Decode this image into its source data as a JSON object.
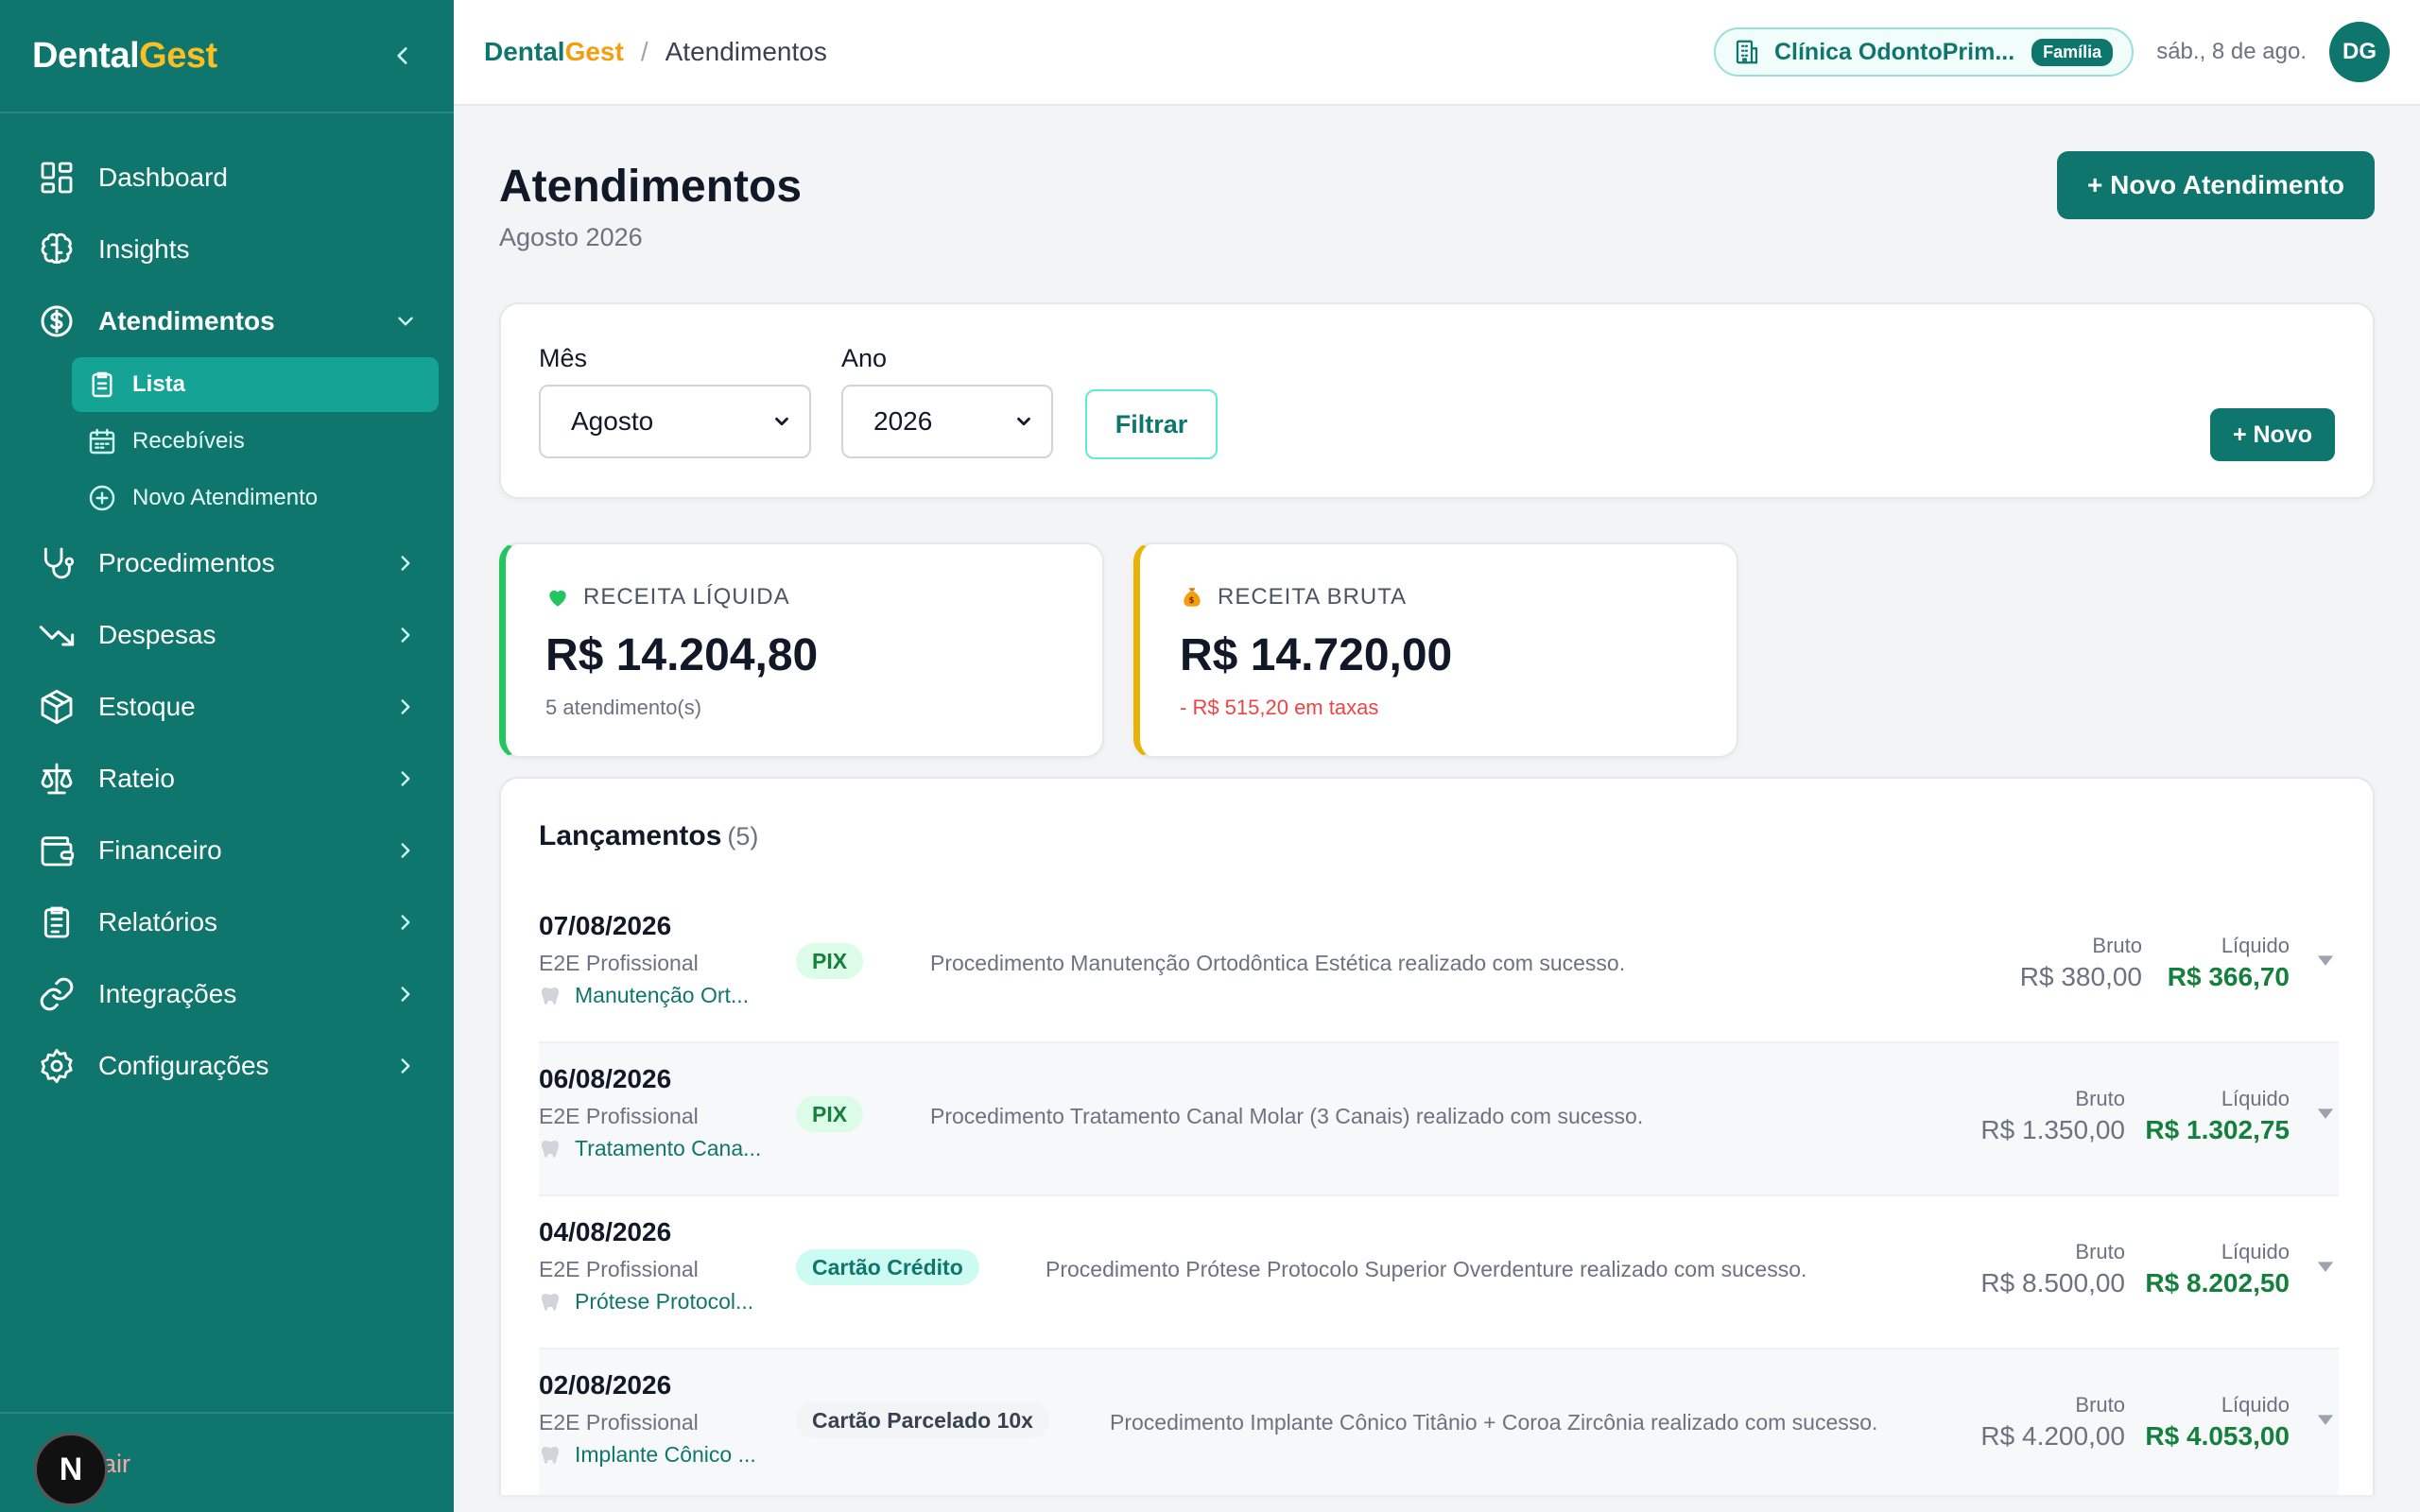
{
  "sidebar": {
    "brand_main": "Dental",
    "brand_accent": "Gest",
    "nav": [
      {
        "label": "Dashboard"
      },
      {
        "label": "Insights"
      },
      {
        "label": "Atendimentos"
      },
      {
        "label": "Procedimentos"
      },
      {
        "label": "Despesas"
      },
      {
        "label": "Estoque"
      },
      {
        "label": "Rateio"
      },
      {
        "label": "Financeiro"
      },
      {
        "label": "Relatórios"
      },
      {
        "label": "Integrações"
      },
      {
        "label": "Configurações"
      }
    ],
    "sub": [
      {
        "label": "Lista"
      },
      {
        "label": "Recebíveis"
      },
      {
        "label": "Novo Atendimento"
      }
    ],
    "logout_label": "Sair",
    "dev_badge": "N"
  },
  "topbar": {
    "brand_main": "Dental",
    "brand_accent": "Gest",
    "separator": "/",
    "page": "Atendimentos",
    "clinic_name": "Clínica OdontoPrim...",
    "clinic_tag": "Família",
    "date": "sáb., 8 de ago.",
    "avatar_initials": "DG"
  },
  "page": {
    "title": "Atendimentos",
    "subtitle": "Agosto 2026",
    "new_button": "+ Novo Atendimento"
  },
  "filters": {
    "month_label": "Mês",
    "month_value": "Agosto",
    "year_label": "Ano",
    "year_value": "2026",
    "filter_button": "Filtrar",
    "new_small_button": "+ Novo"
  },
  "stats": {
    "net": {
      "label": "RECEITA LÍQUIDA",
      "value": "R$ 14.204,80",
      "note": "5 atendimento(s)",
      "color": "#22c55e"
    },
    "gross": {
      "label": "RECEITA BRUTA",
      "value": "R$ 14.720,00",
      "note": "- R$ 515,20 em taxas",
      "color": "#eab308"
    }
  },
  "list": {
    "title": "Lançamentos",
    "count": "(5)",
    "gross_caption": "Bruto",
    "net_caption": "Líquido",
    "rows": [
      {
        "date": "07/08/2026",
        "professional": "E2E Profissional",
        "procedure": "Manutenção Ort...",
        "method": "PIX",
        "description": "Procedimento Manutenção Ortodôntica Estética realizado com sucesso.",
        "gross": "R$ 380,00",
        "net": "R$ 366,70"
      },
      {
        "date": "06/08/2026",
        "professional": "E2E Profissional",
        "procedure": "Tratamento Cana...",
        "method": "PIX",
        "description": "Procedimento Tratamento Canal Molar (3 Canais) realizado com sucesso.",
        "gross": "R$ 1.350,00",
        "net": "R$ 1.302,75"
      },
      {
        "date": "04/08/2026",
        "professional": "E2E Profissional",
        "procedure": "Prótese Protocol...",
        "method": "Cartão Crédito",
        "description": "Procedimento Prótese Protocolo Superior Overdenture realizado com sucesso.",
        "gross": "R$ 8.500,00",
        "net": "R$ 8.202,50"
      },
      {
        "date": "02/08/2026",
        "professional": "E2E Profissional",
        "procedure": "Implante Cônico ...",
        "method": "Cartão Parcelado 10x",
        "description": "Procedimento Implante Cônico Titânio + Coroa Zircônia realizado com sucesso.",
        "gross": "R$ 4.200,00",
        "net": "R$ 4.053,00"
      }
    ]
  },
  "colors": {
    "primary": "#0f766e",
    "accent": "#fbbf24",
    "pix_bg": "#dcfce7",
    "pix_fg": "#15803d",
    "credit_bg": "#ccfbf1",
    "credit_fg": "#0f766e",
    "installment_bg": "#f3f4f6",
    "installment_fg": "#374151"
  }
}
